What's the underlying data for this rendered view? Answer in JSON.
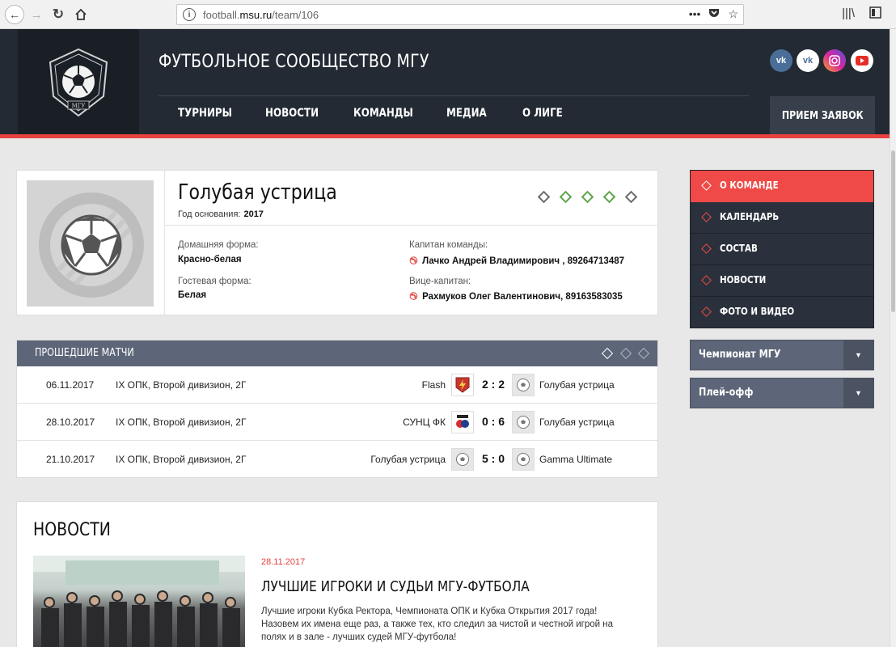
{
  "browser": {
    "url_prefix": "football.",
    "url_domain": "msu.ru",
    "url_path": "/team/106"
  },
  "header": {
    "site_title": "ФУТБОЛЬНОЕ СООБЩЕСТВО МГУ",
    "logo_text": "МГУ",
    "nav": [
      "ТУРНИРЫ",
      "НОВОСТИ",
      "КОМАНДЫ",
      "МЕДИА",
      "О ЛИГЕ"
    ],
    "apply_label": "ПРИЕМ ЗАЯВОК",
    "social": [
      "vk-icon",
      "vk-icon",
      "instagram-icon",
      "youtube-icon"
    ]
  },
  "team": {
    "name": "Голубая устрица",
    "founded_label": "Год основания:",
    "founded_year": "2017",
    "form_results": [
      "loss",
      "win",
      "win",
      "win",
      "loss"
    ],
    "home_kit_label": "Домашняя форма:",
    "home_kit": "Красно-белая",
    "away_kit_label": "Гостевая форма:",
    "away_kit": "Белая",
    "captain_label": "Капитан команды:",
    "captain": "Лачко Андрей Владимирович , 89264713487",
    "vice_label": "Вице-капитан:",
    "vice": "Рахмуков Олег Валентинович, 89163583035"
  },
  "matches": {
    "title": "ПРОШЕДШИЕ МАТЧИ",
    "rows": [
      {
        "date": "06.11.2017",
        "tournament": "IX ОПК, Второй дивизион, 2Г",
        "home": "Flash",
        "score": "2 : 2",
        "away": "Голубая устрица"
      },
      {
        "date": "28.10.2017",
        "tournament": "IX ОПК, Второй дивизион, 2Г",
        "home": "СУНЦ ФК",
        "score": "0 : 6",
        "away": "Голубая устрица"
      },
      {
        "date": "21.10.2017",
        "tournament": "IX ОПК, Второй дивизион, 2Г",
        "home": "Голубая устрица",
        "score": "5 : 0",
        "away": "Gamma Ultimate"
      }
    ]
  },
  "news": {
    "section_title": "НОВОСТИ",
    "date": "28.11.2017",
    "headline": "ЛУЧШИЕ ИГРОКИ И СУДЬИ МГУ-ФУТБОЛА",
    "text": "Лучшие игроки Кубка Ректора, Чемпионата ОПК и Кубка Открытия 2017 года! Назовем их имена еще раз, а также тех, кто следил за чистой и честной игрой на полях и в зале - лучших судей МГУ-футбола!"
  },
  "sidebar": {
    "menu": [
      "О КОМАНДЕ",
      "КАЛЕНДАРЬ",
      "СОСТАВ",
      "НОВОСТИ",
      "ФОТО И ВИДЕО"
    ],
    "dropdowns": [
      "Чемпионат МГУ",
      "Плей-офф"
    ]
  },
  "colors": {
    "accent": "#ef4a47",
    "header_bg": "#232a33",
    "panel_header": "#5d6578",
    "win": "#5da34a"
  }
}
